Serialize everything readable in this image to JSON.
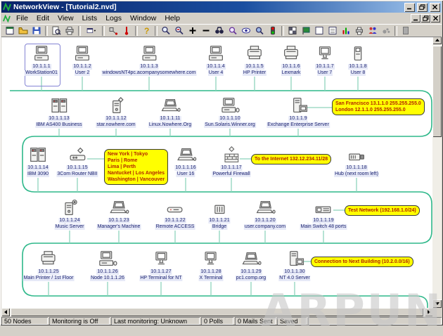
{
  "window": {
    "title": "NetworkView - [Tutorial2.nvd]"
  },
  "menu": {
    "items": [
      "File",
      "Edit",
      "View",
      "Lists",
      "Logs",
      "Window",
      "Help"
    ]
  },
  "toolbar": {
    "icons": [
      "new",
      "open-folder",
      "save",
      "zoom-page",
      "print",
      "window",
      "dropdown",
      "node-tool",
      "thermometer",
      "help",
      "zoom-in",
      "zoom-out",
      "plus",
      "minus",
      "binoculars",
      "magnifier-doc",
      "eye",
      "zoom-reset",
      "traffic-light",
      "map",
      "flag",
      "list-window",
      "list-window-2",
      "bar-chart",
      "printer-list",
      "users",
      "paw",
      "box"
    ]
  },
  "canvas": {
    "watermark": "ARPUN",
    "nodes": [
      {
        "ip": "10.1.1.1",
        "label": "WorkStation01",
        "icon": "desktop",
        "selected": true
      },
      {
        "ip": "10.1.1.2",
        "label": "User 2",
        "icon": "desktop"
      },
      {
        "ip": "10.1.1.3",
        "label": "windowsNT4pc.acompanysomewhere.com",
        "icon": "desktop"
      },
      {
        "ip": "10.1.1.4",
        "label": "User 4",
        "icon": "desktop"
      },
      {
        "ip": "10.1.1.5",
        "label": "HP Printer",
        "icon": "printer"
      },
      {
        "ip": "10.1.1.6",
        "label": "Lexmark",
        "icon": "printer"
      },
      {
        "ip": "10.1.1.7",
        "label": "User 7",
        "icon": "monitor"
      },
      {
        "ip": "10.1.1.8",
        "label": "User 8",
        "icon": "smallbox"
      },
      {
        "ip": "10.1.1.13",
        "label": "IBM AS400 Business",
        "icon": "mainframe"
      },
      {
        "ip": "10.1.1.12",
        "label": "star.nowhere.com",
        "icon": "tower-badge"
      },
      {
        "ip": "10.1.1.11",
        "label": "Linux.Nowhere.Org",
        "icon": "laptop"
      },
      {
        "ip": "10.1.1.10",
        "label": "Sun.Solaris.Winner.org",
        "icon": "desktop-mouse"
      },
      {
        "ip": "10.1.1.9",
        "label": "Exchange Enterprise Server",
        "icon": "server"
      },
      {
        "ip": "10.1.1.14",
        "label": "IBM 3090",
        "icon": "mainframe"
      },
      {
        "ip": "10.1.1.15",
        "label": "3Com Router NBII",
        "icon": "router"
      },
      {
        "ip": "10.1.1.16",
        "label": "User 16",
        "icon": "laptop"
      },
      {
        "ip": "10.1.1.17",
        "label": "Powerful Firewall",
        "icon": "firewall"
      },
      {
        "ip": "10.1.1.18",
        "label": "Hub (next room left)",
        "icon": "hub"
      },
      {
        "ip": "10.1.1.24",
        "label": "Music Server",
        "icon": "tower-disc"
      },
      {
        "ip": "10.1.1.23",
        "label": "Manager's Machine",
        "icon": "laptop"
      },
      {
        "ip": "10.1.1.22",
        "label": "Remote ACCESS",
        "icon": "modem"
      },
      {
        "ip": "10.1.1.21",
        "label": "Bridge",
        "icon": "bridge"
      },
      {
        "ip": "10.1.1.20",
        "label": "user.company.com",
        "icon": "laptop"
      },
      {
        "ip": "10.1.1.19",
        "label": "Main Switch 48 ports",
        "icon": "switch"
      },
      {
        "ip": "10.1.1.25",
        "label": "Main Printer / 1st Floor",
        "icon": "printer"
      },
      {
        "ip": "10.1.1.26",
        "label": "Node 10.1.1.26",
        "icon": "desktop-mouse"
      },
      {
        "ip": "10.1.1.27",
        "label": "HP Terminal for NT",
        "icon": "monitor"
      },
      {
        "ip": "10.1.1.28",
        "label": "X Terminal",
        "icon": "monitor"
      },
      {
        "ip": "10.1.1.29",
        "label": "pc1.comp.org",
        "icon": "laptop"
      },
      {
        "ip": "10.1.1.30",
        "label": "NT 4.0 Server",
        "icon": "server"
      }
    ],
    "callouts": {
      "san_francisco": {
        "lines": [
          "San Francisco 13.1.1.0 255.255.255.0",
          "London 12.1.1.0 255.255.255.0"
        ]
      },
      "cities": {
        "lines": [
          "New York  |  Tokyo",
          "Paris  |  Rome",
          "Lima  |  Perth",
          "Nantucket  |  Los Angeles",
          "Washington  |  Vancouver"
        ]
      },
      "internet": {
        "text": "To the Internet 132.12.234.11/28"
      },
      "test_network": {
        "text": "Test Network (192.168.1.0/24)"
      },
      "next_building": {
        "text": "Connection to Next Building (10.2.0.0/16)"
      }
    }
  },
  "statusbar": {
    "segments": [
      "50 Nodes",
      "Monitoring is Off",
      "Last monitoring: Unknown",
      "0 Polls",
      "0 Mails Sent",
      "Saved"
    ]
  },
  "colors": {
    "bus_line": "#2eb88a",
    "connector": "#8fd4bc",
    "callout_bg": "#ffff00",
    "callout_text": "#b22400",
    "titlebar": "#0a246a",
    "chrome": "#d4d0c8",
    "selection": "#8484d4"
  }
}
